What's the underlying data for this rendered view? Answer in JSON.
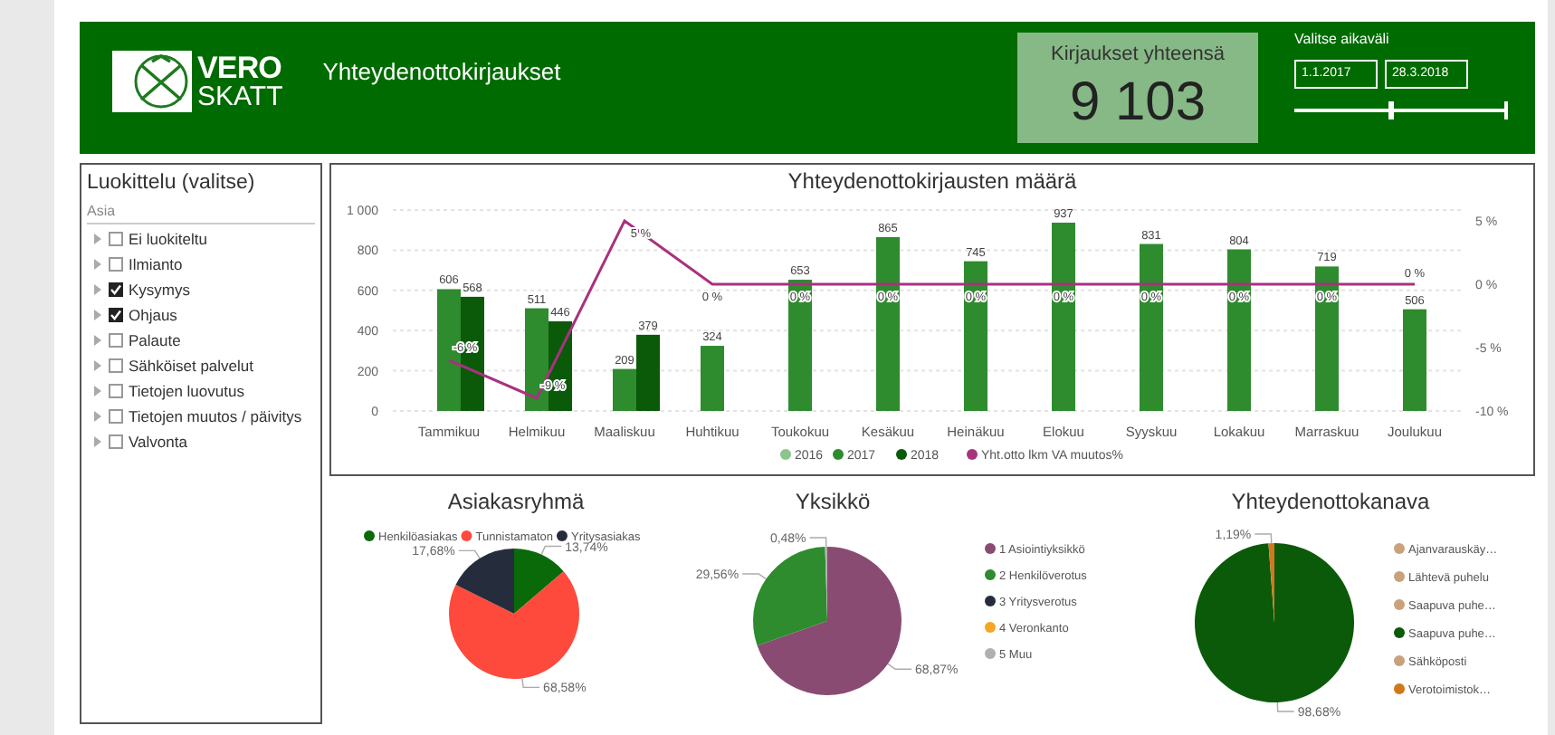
{
  "header": {
    "logo_top": "VERO",
    "logo_bottom": "SKATT",
    "title": "Yhteydenottokirjaukset",
    "kpi": {
      "label": "Kirjaukset yhteensä",
      "value": "9 103"
    },
    "date_range": {
      "label": "Valitse aikaväli",
      "start": "1.1.2017",
      "end": "28.3.2018",
      "level": 0.45
    }
  },
  "filter": {
    "title": "Luokittelu (valitse)",
    "column": "Asia",
    "items": [
      {
        "label": "Ei luokiteltu",
        "checked": false
      },
      {
        "label": "Ilmianto",
        "checked": false
      },
      {
        "label": "Kysymys",
        "checked": true
      },
      {
        "label": "Ohjaus",
        "checked": true
      },
      {
        "label": "Palaute",
        "checked": false
      },
      {
        "label": "Sähköiset palvelut",
        "checked": false
      },
      {
        "label": "Tietojen luovutus",
        "checked": false
      },
      {
        "label": "Tietojen muutos / päivitys",
        "checked": false
      },
      {
        "label": "Valvonta",
        "checked": false
      }
    ]
  },
  "chart": {
    "chart_data": {
      "type": "bar",
      "title": "Yhteydenottokirjausten määrä",
      "categories": [
        "Tammikuu",
        "Helmikuu",
        "Maaliskuu",
        "Huhtikuu",
        "Toukokuu",
        "Kesäkuu",
        "Heinäkuu",
        "Elokuu",
        "Syyskuu",
        "Lokakuu",
        "Marraskuu",
        "Joulukuu"
      ],
      "ylim": [
        0,
        1000
      ],
      "yticks": [
        0,
        200,
        400,
        600,
        800,
        {
          "value": 1000,
          "label": "1 000"
        }
      ],
      "y2ticks": [
        {
          "value": 5,
          "label": "5 %"
        },
        {
          "value": 0,
          "label": "0 %"
        },
        {
          "value": -5,
          "label": "-5 %"
        },
        {
          "value": -10,
          "label": "-10 %"
        }
      ],
      "y2lim": [
        -10,
        5
      ],
      "grid": true,
      "legend": "bottom",
      "data_labels": true,
      "series": [
        {
          "name": "2016",
          "color": "#8cc48c",
          "type": "bar",
          "values": [
            null,
            null,
            null,
            null,
            null,
            null,
            null,
            null,
            null,
            null,
            null,
            null
          ]
        },
        {
          "name": "2017",
          "color": "#2e8b2e",
          "type": "bar",
          "values": [
            606,
            511,
            209,
            324,
            653,
            865,
            745,
            937,
            831,
            804,
            719,
            506
          ],
          "value_labels": [
            "606",
            "511",
            "209",
            "324",
            "653",
            "865",
            "745",
            "937",
            "831",
            "804",
            "719",
            "506"
          ]
        },
        {
          "name": "2018",
          "color": "#0a5a0a",
          "type": "bar",
          "values": [
            568,
            446,
            379,
            null,
            null,
            null,
            null,
            null,
            null,
            null,
            null,
            null
          ],
          "value_labels": [
            "568",
            "446",
            "379",
            null,
            null,
            null,
            null,
            null,
            null,
            null,
            null,
            null
          ]
        },
        {
          "name": "Yht.otto lkm VA muutos%",
          "color": "#a8327e",
          "type": "line",
          "axis": "y2",
          "values": [
            -6,
            -9,
            5,
            0,
            0,
            0,
            0,
            0,
            0,
            0,
            0,
            0
          ],
          "value_labels": [
            "-6 %",
            "-9 %",
            "5 %",
            "0 %",
            "0 %",
            "0 %",
            "0 %",
            "0 %",
            "0 %",
            "0 %",
            "0 %",
            "0 %"
          ]
        }
      ]
    }
  },
  "pies": [
    {
      "chart_data": {
        "type": "pie",
        "title": "Asiakasryhmä",
        "legend": "top",
        "categories": [
          "Henkilöasiakas",
          "Tunnistamaton",
          "Yritysasiakas"
        ],
        "colors": [
          "#0a6a0a",
          "#fd4a3c",
          "#252d3c"
        ],
        "values": [
          13.74,
          68.58,
          17.68
        ],
        "value_labels": [
          "13,74%",
          "68,58%",
          "17,68%"
        ]
      }
    },
    {
      "chart_data": {
        "type": "pie",
        "title": "Yksikkö",
        "legend": "right",
        "categories": [
          "1 Asiointiyksikkö",
          "2 Henkilöverotus",
          "3 Yritysverotus",
          "4 Veronkanto",
          "5 Muu"
        ],
        "colors": [
          "#8a4b73",
          "#2e8b2e",
          "#252d3c",
          "#f5a623",
          "#b0b0b0"
        ],
        "values": [
          68.87,
          29.56,
          null,
          null,
          0.48
        ],
        "value_labels": [
          "68,87%",
          "29,56%",
          null,
          null,
          "0,48%"
        ]
      }
    },
    {
      "chart_data": {
        "type": "pie",
        "title": "Yhteydenottokanava",
        "legend": "right",
        "categories": [
          "Ajanvarauskäy…",
          "Lähtevä puhelu",
          "Saapuva puhe…",
          "Saapuva puhe…",
          "Sähköposti",
          "Verotoimistok…"
        ],
        "colors": [
          "#c9a27c",
          "#c9a27c",
          "#c9a27c",
          "#0a5a0a",
          "#c9a27c",
          "#d0781c"
        ],
        "values": [
          null,
          null,
          null,
          98.68,
          null,
          1.19
        ],
        "value_labels": [
          null,
          null,
          null,
          "98,68%",
          null,
          "1,19%"
        ]
      }
    }
  ]
}
